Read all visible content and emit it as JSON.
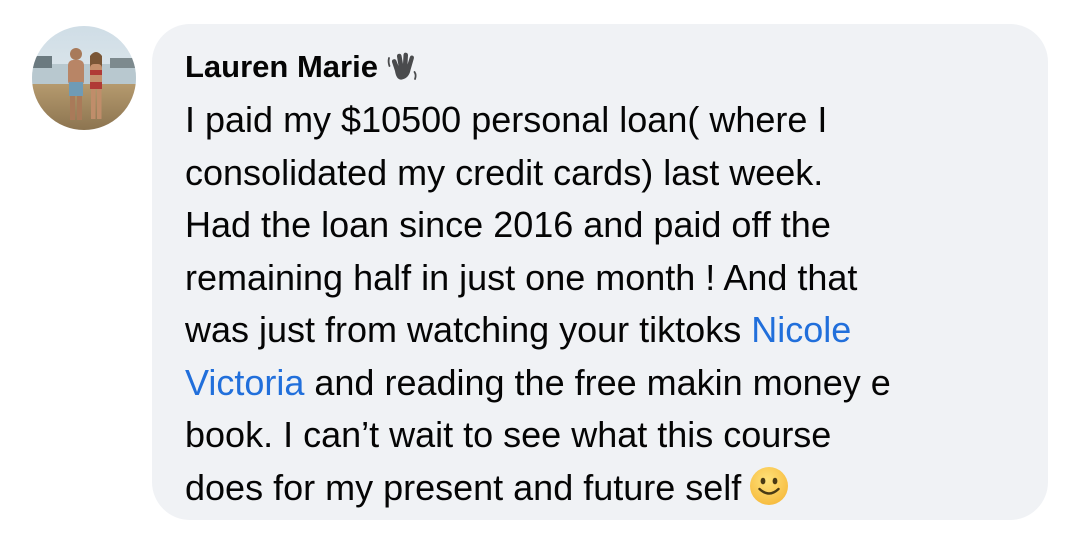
{
  "comment": {
    "author": "Lauren Marie",
    "author_badge_icon": "waving-hand-icon",
    "avatar_icon": "profile-photo",
    "lines": [
      [
        {
          "text": "I paid my $10500 personal loan( where I"
        }
      ],
      [
        {
          "text": "consolidated my credit cards) last week."
        }
      ],
      [
        {
          "text": "Had the loan since 2016 and paid off the"
        }
      ],
      [
        {
          "text": "remaining half in just one month ! And that"
        }
      ],
      [
        {
          "text": "was just from watching your tiktoks "
        },
        {
          "text": "Nicole",
          "mention": true
        }
      ],
      [
        {
          "text": "Victoria",
          "mention": true
        },
        {
          "text": " and reading the free makin money e"
        }
      ],
      [
        {
          "text": "book. I can’t wait to see what this course"
        }
      ],
      [
        {
          "text": "does for my present and future self"
        }
      ]
    ],
    "trailing_emoji": "slightly-smiling-face-icon"
  },
  "colors": {
    "bubble_background": "#f0f2f5",
    "text": "#050505",
    "mention": "#216fdb"
  }
}
